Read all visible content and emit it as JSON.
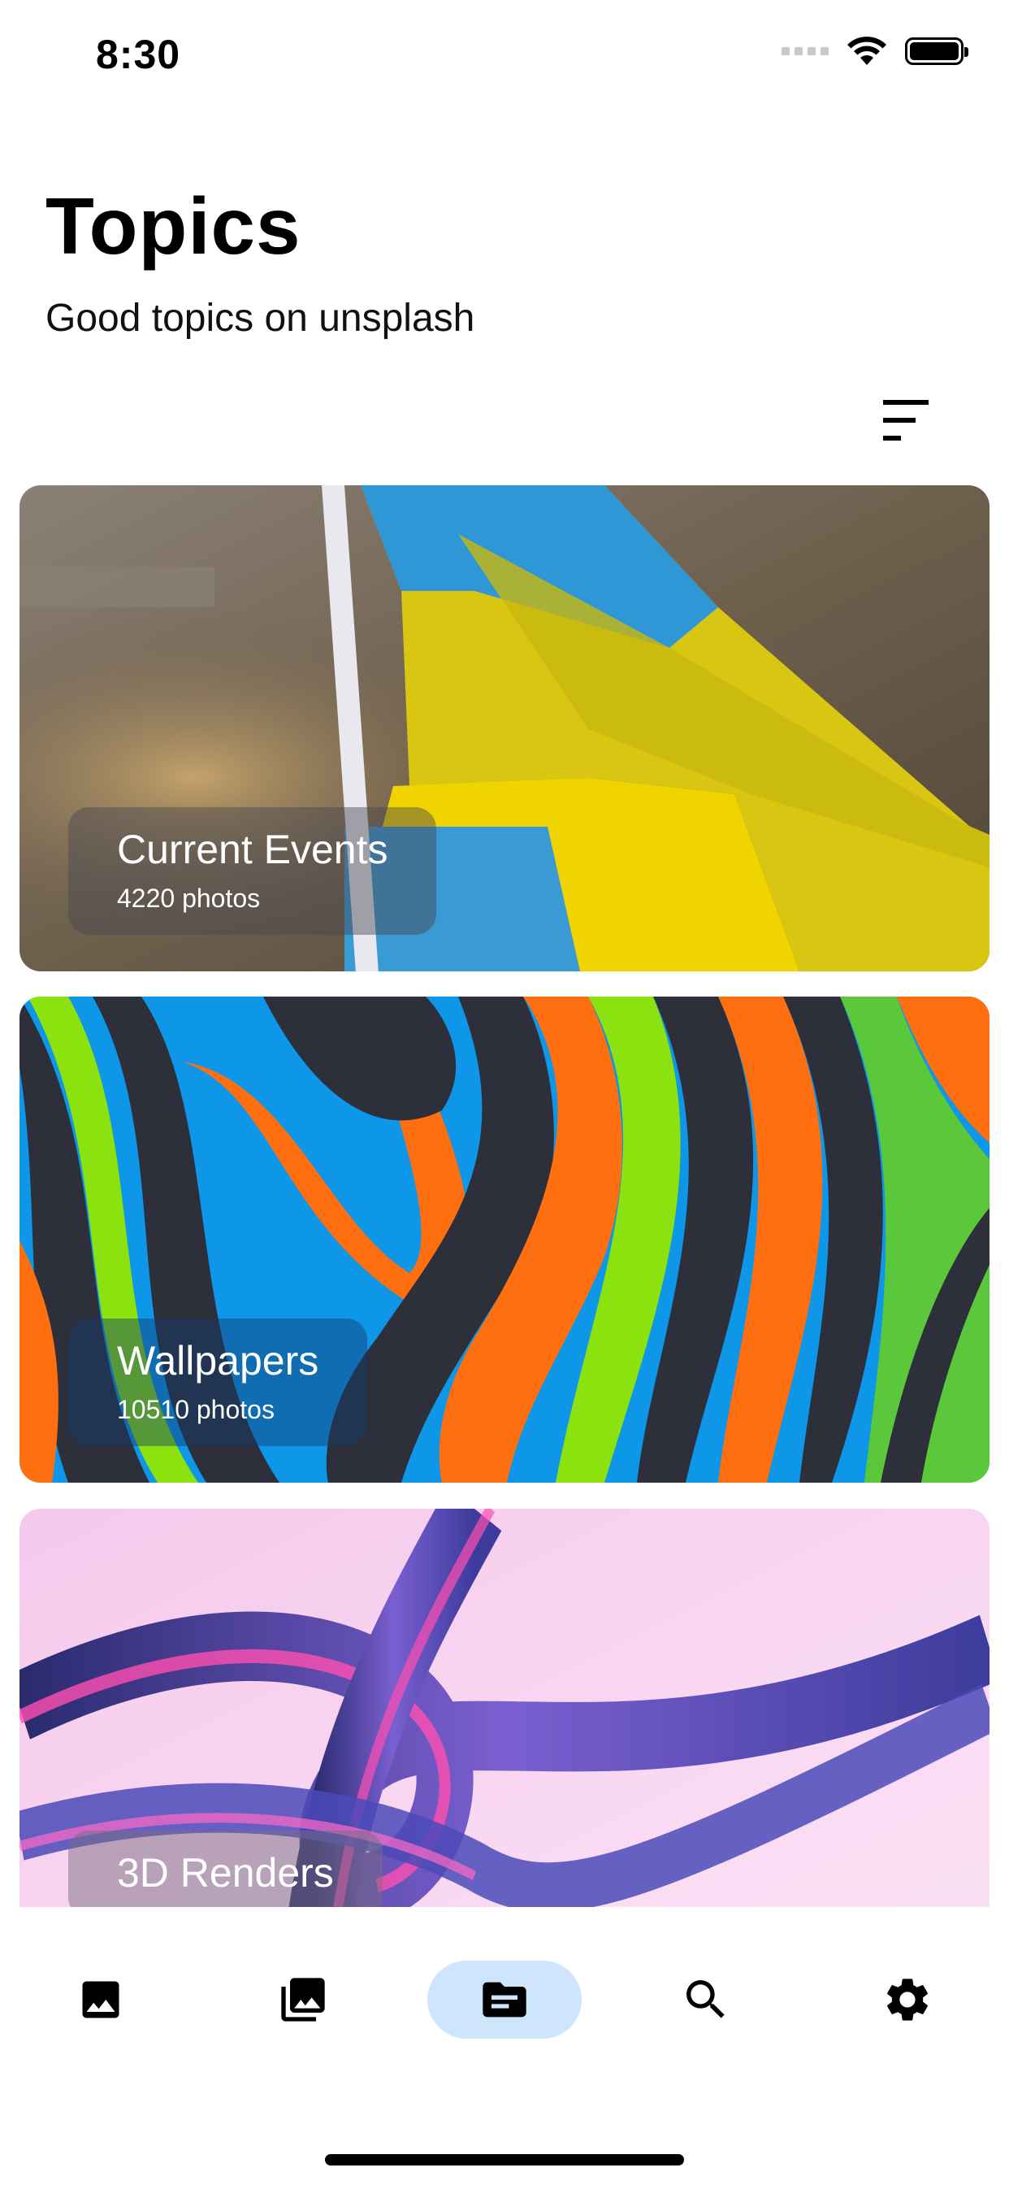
{
  "status_bar": {
    "time": "8:30"
  },
  "header": {
    "title": "Topics",
    "subtitle": "Good topics on unsplash"
  },
  "toolbar": {
    "sort_icon": "sort-icon"
  },
  "topics": [
    {
      "title": "Current Events",
      "count": "4220 photos"
    },
    {
      "title": "Wallpapers",
      "count": "10510 photos"
    },
    {
      "title": "3D Renders",
      "count": ""
    }
  ],
  "bottom_nav": {
    "items": [
      {
        "icon": "image-icon",
        "active": false
      },
      {
        "icon": "photo-library-icon",
        "active": false
      },
      {
        "icon": "topic-folder-icon",
        "active": true
      },
      {
        "icon": "search-icon",
        "active": false
      },
      {
        "icon": "settings-icon",
        "active": false
      }
    ],
    "active_color": "#cfe5fb"
  }
}
